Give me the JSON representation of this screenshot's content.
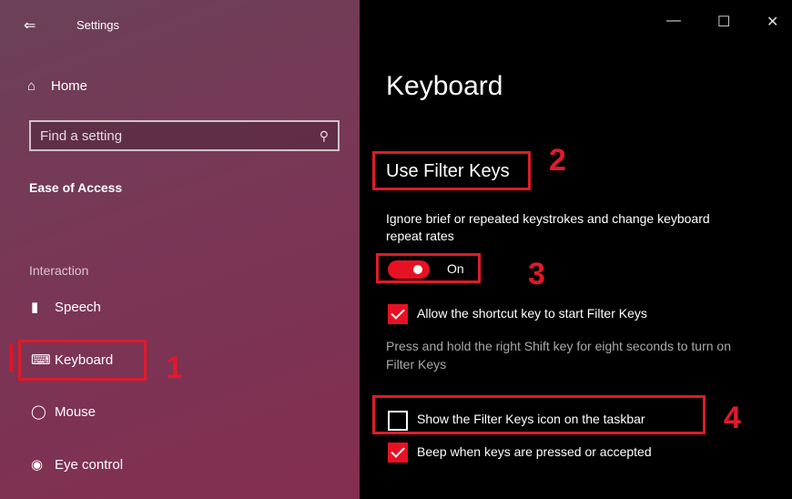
{
  "window": {
    "title": "Settings"
  },
  "sidebar": {
    "home_label": "Home",
    "search_placeholder": "Find a setting",
    "section_title": "Ease of Access",
    "group_label": "Interaction",
    "items": [
      {
        "label": "Speech",
        "icon": "microphone-icon"
      },
      {
        "label": "Keyboard",
        "icon": "keyboard-icon",
        "selected": true
      },
      {
        "label": "Mouse",
        "icon": "mouse-icon"
      },
      {
        "label": "Eye control",
        "icon": "eye-control-icon"
      }
    ]
  },
  "main": {
    "page_title": "Keyboard",
    "section_title": "Use Filter Keys",
    "description": "Ignore brief or repeated keystrokes and change keyboard repeat rates",
    "toggle": {
      "state_label": "On",
      "on": true
    },
    "options": [
      {
        "label": "Allow the shortcut key to start Filter Keys",
        "checked": true
      },
      {
        "label": "Show the Filter Keys icon on the taskbar",
        "checked": false
      },
      {
        "label": "Beep when keys are pressed or accepted",
        "checked": true
      }
    ],
    "shortcut_hint": "Press and hold the right Shift key for eight seconds to turn on Filter Keys"
  },
  "annotations": [
    "1",
    "2",
    "3",
    "4"
  ],
  "colors": {
    "accent": "#e81123",
    "annotation_red": "#e01a2a",
    "main_bg": "#000000",
    "sidebar_bg": "#8a3f62"
  }
}
